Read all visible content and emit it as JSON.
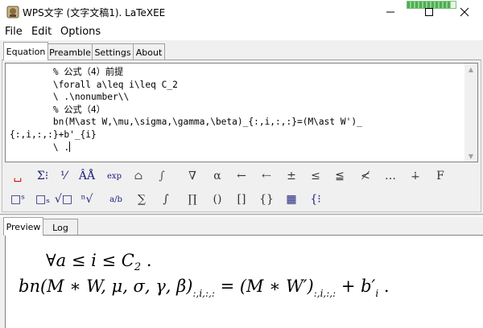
{
  "window": {
    "title": "WPS文字 (文字文稿1). LaTeXEE",
    "progress_fraction": 0.9,
    "minimize_icon": "minimize-icon",
    "maximize_icon": "maximize-icon",
    "close_icon": "close-icon"
  },
  "menu": {
    "file": "File",
    "edit": "Edit",
    "options": "Options"
  },
  "tabs_top": [
    "Equation",
    "Preamble",
    "Settings",
    "About"
  ],
  "editor": {
    "lines": [
      "        % 公式（4）前提",
      "        \\forall a\\leq i\\leq C_2",
      "        \\ .\\nonumber\\\\",
      "        % 公式（4）",
      "        bn(M\\ast W,\\mu,\\sigma,\\gamma,\\beta)_{:,i,:,:}=(M\\ast W')_",
      "{:,i,:,:}+b'_{i}",
      "        \\ ."
    ]
  },
  "toolbar_row1": [
    {
      "name": "space-icon",
      "glyph": "␣",
      "color": "#d01010"
    },
    {
      "name": "sum-symbols-icon",
      "glyph": "Σ⁝",
      "color": "#202080"
    },
    {
      "name": "fraction-icon",
      "glyph": "⅟",
      "color": "#202080"
    },
    {
      "name": "accents-icon",
      "glyph": "ÂÅ",
      "color": "#202080"
    },
    {
      "name": "function-names-icon",
      "glyph": "exp",
      "color": "#202080"
    },
    {
      "name": "box-icon",
      "glyph": "⌂",
      "color": "#555555"
    },
    {
      "name": "integral-bracket-icon",
      "glyph": "∫",
      "color": "#555555"
    },
    {
      "name": "nabla-icon",
      "glyph": "∇",
      "color": "#333333"
    },
    {
      "name": "alpha-icon",
      "glyph": "α",
      "color": "#333333"
    },
    {
      "name": "left-arrow-icon",
      "glyph": "←",
      "color": "#333333"
    },
    {
      "name": "long-left-arrow-icon",
      "glyph": "⇠",
      "color": "#333333"
    },
    {
      "name": "plus-minus-icon",
      "glyph": "±",
      "color": "#333333"
    },
    {
      "name": "leq-icon",
      "glyph": "≤",
      "color": "#333333"
    },
    {
      "name": "leqq-icon",
      "glyph": "≦",
      "color": "#333333"
    },
    {
      "name": "not-less-icon",
      "glyph": "≮",
      "color": "#333333"
    },
    {
      "name": "ellipsis-icon",
      "glyph": "…",
      "color": "#333333"
    },
    {
      "name": "dotplus-icon",
      "glyph": "∔",
      "color": "#333333"
    },
    {
      "name": "function-f-icon",
      "glyph": "F",
      "color": "#333333"
    }
  ],
  "toolbar_row2": [
    {
      "name": "superscript-icon",
      "glyph": "□ˢ",
      "color": "#202080"
    },
    {
      "name": "subscript-icon",
      "glyph": "□ₛ",
      "color": "#202080"
    },
    {
      "name": "sqrt-icon",
      "glyph": "√□",
      "color": "#202080"
    },
    {
      "name": "nth-root-icon",
      "glyph": "ⁿ√",
      "color": "#202080"
    },
    {
      "name": "frac-ab-icon",
      "glyph": "a/b",
      "color": "#202080"
    },
    {
      "name": "sum-icon",
      "glyph": "∑",
      "color": "#333333"
    },
    {
      "name": "integral-icon",
      "glyph": "∫",
      "color": "#333333"
    },
    {
      "name": "product-icon",
      "glyph": "∏",
      "color": "#333333"
    },
    {
      "name": "parentheses-icon",
      "glyph": "()",
      "color": "#333333"
    },
    {
      "name": "brackets-icon",
      "glyph": "[]",
      "color": "#333333"
    },
    {
      "name": "braces-icon",
      "glyph": "{}",
      "color": "#333333"
    },
    {
      "name": "matrix-icon",
      "glyph": "▦",
      "color": "#202080"
    },
    {
      "name": "cases-icon",
      "glyph": "{⁝",
      "color": "#202080"
    }
  ],
  "tabs_bottom": [
    "Preview",
    "Log"
  ]
}
